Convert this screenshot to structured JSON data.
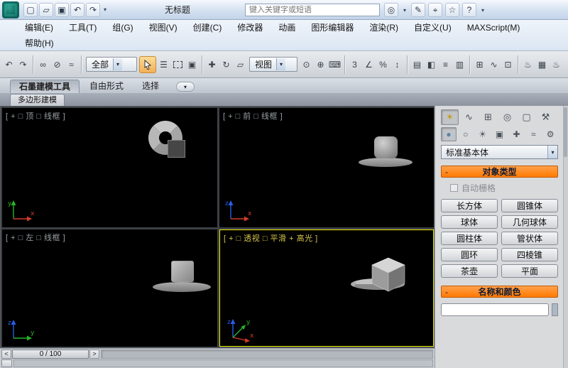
{
  "titlebar": {
    "title": "无标题",
    "search_placeholder": "键入关键字或短语"
  },
  "menubar": {
    "items": [
      "编辑(E)",
      "工具(T)",
      "组(G)",
      "视图(V)",
      "创建(C)",
      "修改器",
      "动画",
      "图形编辑器",
      "渲染(R)",
      "自定义(U)",
      "MAXScript(M)"
    ],
    "items_row2": [
      "帮助(H)"
    ]
  },
  "toolbar": {
    "selection_filter_value": "全部",
    "coordinate_system_value": "视图"
  },
  "ribbon": {
    "tabs": [
      "石墨建模工具",
      "自由形式",
      "选择"
    ],
    "panel_tab": "多边形建模"
  },
  "viewports": {
    "top_label": "[ + □ 顶 □ 线框 ]",
    "front_label": "[ + □ 前 □ 线框 ]",
    "left_label": "[ + □ 左 □ 线框 ]",
    "perspective_label": "[ + □ 透视 □ 平滑 + 高光 ]",
    "axis_x": "x",
    "axis_y": "y",
    "axis_z": "z"
  },
  "command_panel": {
    "category_value": "标准基本体",
    "object_type_title": "对象类型",
    "autogrid_label": "自动栅格",
    "primitive_buttons": [
      "长方体",
      "圆锥体",
      "球体",
      "几何球体",
      "圆柱体",
      "管状体",
      "圆环",
      "四棱锥",
      "茶壶",
      "平面"
    ],
    "name_color_title": "名称和颜色",
    "name_value": ""
  },
  "timeline": {
    "frame_display": "0 / 100",
    "prev": "<",
    "next": ">"
  },
  "icons": {
    "minus": "-",
    "caret": "▾",
    "new": "▢",
    "open": "▱",
    "save": "▣",
    "undo": "↶",
    "redo": "↷",
    "search": "◎",
    "pen": "✎",
    "mouse": "⌖",
    "star": "☆",
    "help": "?",
    "link": "∞",
    "unlink": "⊘",
    "bind": "≈",
    "byname": "☰",
    "wincross": "▣",
    "move": "✚",
    "rotate": "↻",
    "scale": "▱",
    "center": "⊙",
    "manip": "⊕",
    "kbd": "⌨",
    "snap3": "3",
    "anglesnap": "∠",
    "pctsnap": "%",
    "spinsnap": "↕",
    "namedsel": "▤",
    "mirror": "◧",
    "align": "≡",
    "layers": "▥",
    "graphite": "⊞",
    "curves": "∿",
    "schematic": "⊡",
    "teapot": "♨",
    "frame": "▦",
    "create": "✶",
    "modify": "∿",
    "hierarchy": "⊞",
    "motion": "◎",
    "display": "▢",
    "utilities": "⚒",
    "geometry": "●",
    "shapes": "○",
    "lights": "☀",
    "cameras": "▣",
    "helpers": "✚",
    "spacewarps": "≈",
    "systems": "⚙"
  },
  "colors": {
    "rollout_header_orange": "#ff7a00",
    "active_viewport_border": "#ecec00",
    "active_tool_highlight": "#f1b058",
    "viewport_background": "#000000"
  }
}
